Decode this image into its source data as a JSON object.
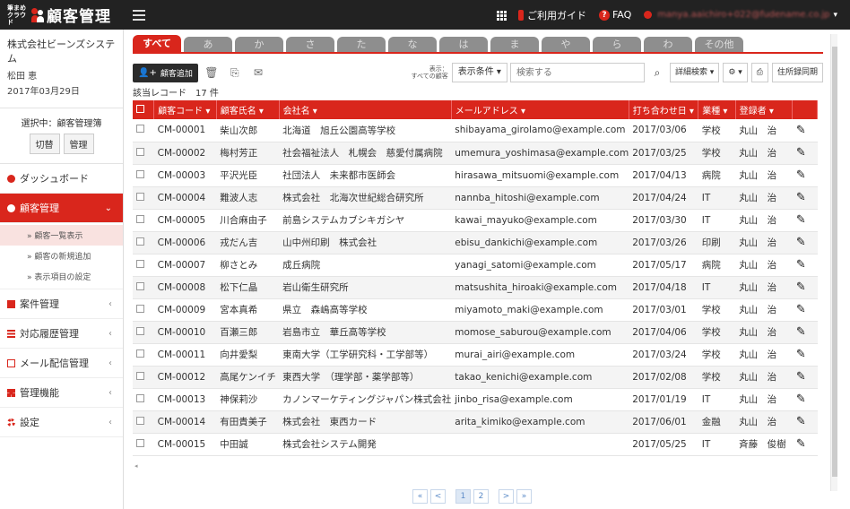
{
  "header": {
    "brand_small": "筆まめ クラウド",
    "title": "顧客管理",
    "guide": "ご利用ガイド",
    "faq": "FAQ",
    "user_email": "manya.aaichiro+022@fudename.co.jp",
    "colors": {
      "bar": "#222222",
      "accent": "#d9261c"
    }
  },
  "sidebar": {
    "company": "株式会社ビーンズシステム",
    "user": "松田 恵",
    "date": "2017年03月29日",
    "selection_label": "選択中：顧客管理簿",
    "switch_btn": "切替",
    "manage_btn": "管理",
    "items": [
      {
        "label": "ダッシュボード",
        "icon": "info-icon"
      },
      {
        "label": "顧客管理",
        "icon": "users-icon"
      },
      {
        "label": "案件管理",
        "icon": "doc-icon"
      },
      {
        "label": "対応履歴管理",
        "icon": "list-icon"
      },
      {
        "label": "メール配信管理",
        "icon": "mail-icon"
      },
      {
        "label": "管理機能",
        "icon": "grid-icon"
      },
      {
        "label": "設定",
        "icon": "gear-icon"
      }
    ],
    "sub_items": [
      "» 顧客一覧表示",
      "» 顧客の新規追加",
      "» 表示項目の設定"
    ]
  },
  "tabs": [
    "すべて",
    "あ",
    "か",
    "さ",
    "た",
    "な",
    "は",
    "ま",
    "や",
    "ら",
    "わ",
    "その他"
  ],
  "toolbar": {
    "add": "顧客追加",
    "display_label_1": "表示：",
    "display_label_2": "すべての顧客",
    "condition": "表示条件 ▾",
    "search_placeholder": "検索する",
    "detail_search": "詳細検索 ▾",
    "address_sync": "住所録同期"
  },
  "record_count": "該当レコード　17 件",
  "columns": [
    "顧客コード ▾",
    "顧客氏名 ▾",
    "会社名 ▾",
    "メールアドレス ▾",
    "打ち合わせ日 ▾",
    "業種 ▾",
    "登録者 ▾"
  ],
  "rows": [
    [
      "CM-00001",
      "柴山次郎",
      "北海道　旭丘公園高等学校",
      "shibayama_girolamo@example.com",
      "2017/03/06",
      "学校",
      "丸山　治"
    ],
    [
      "CM-00002",
      "梅村芳正",
      "社会福祉法人　札幌会　慈愛付属病院",
      "umemura_yoshimasa@example.com",
      "2017/03/25",
      "学校",
      "丸山　治"
    ],
    [
      "CM-00003",
      "平沢光臣",
      "社団法人　未来都市医師会",
      "hirasawa_mitsuomi@example.com",
      "2017/04/13",
      "病院",
      "丸山　治"
    ],
    [
      "CM-00004",
      "難波人志",
      "株式会社　北海次世紀総合研究所",
      "nannba_hitoshi@example.com",
      "2017/04/24",
      "IT",
      "丸山　治"
    ],
    [
      "CM-00005",
      "川合麻由子",
      "前島システムカブシキガシヤ",
      "kawai_mayuko@example.com",
      "2017/03/30",
      "IT",
      "丸山　治"
    ],
    [
      "CM-00006",
      "戎だん吉",
      "山中州印刷　株式会社",
      "ebisu_dankichi@example.com",
      "2017/03/26",
      "印刷",
      "丸山　治"
    ],
    [
      "CM-00007",
      "柳さとみ",
      "成丘病院",
      "yanagi_satomi@example.com",
      "2017/05/17",
      "病院",
      "丸山　治"
    ],
    [
      "CM-00008",
      "松下仁晶",
      "岩山衛生研究所",
      "matsushita_hiroaki@example.com",
      "2017/04/18",
      "IT",
      "丸山　治"
    ],
    [
      "CM-00009",
      "宮本真希",
      "県立　森嶋高等学校",
      "miyamoto_maki@example.com",
      "2017/03/01",
      "学校",
      "丸山　治"
    ],
    [
      "CM-00010",
      "百瀬三郎",
      "岩島市立　華丘高等学校",
      "momose_saburou@example.com",
      "2017/04/06",
      "学校",
      "丸山　治"
    ],
    [
      "CM-00011",
      "向井愛梨",
      "東南大学（工学研究科・工学部等）",
      "murai_airi@example.com",
      "2017/03/24",
      "学校",
      "丸山　治"
    ],
    [
      "CM-00012",
      "高尾ケンイチ",
      "東西大学　（理学部・薬学部等）",
      "takao_kenichi@example.com",
      "2017/02/08",
      "学校",
      "丸山　治"
    ],
    [
      "CM-00013",
      "神保莉沙",
      "カノンマーケティングジャパン株式会社",
      "jinbo_risa@example.com",
      "2017/01/19",
      "IT",
      "丸山　治"
    ],
    [
      "CM-00014",
      "有田貴美子",
      "株式会社　東西カード",
      "arita_kimiko@example.com",
      "2017/06/01",
      "金融",
      "丸山　治"
    ],
    [
      "CM-00015",
      "中田誠",
      "株式会社システム開発",
      "",
      "2017/05/25",
      "IT",
      "斉藤　俊樹"
    ]
  ],
  "pager": [
    "«",
    "<",
    "1",
    "2",
    ">",
    "»"
  ]
}
